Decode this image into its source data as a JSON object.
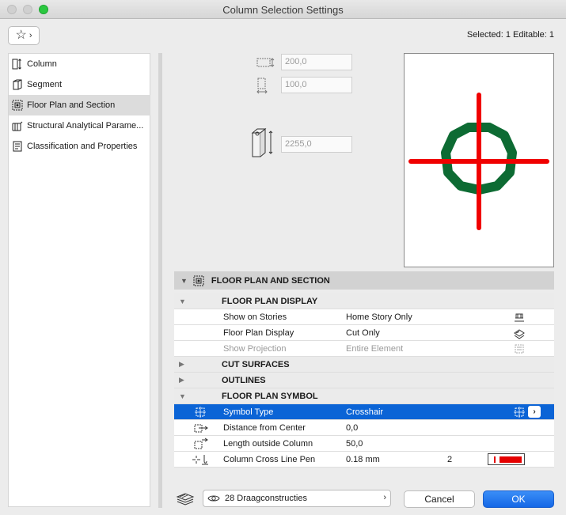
{
  "window": {
    "title": "Column Selection Settings"
  },
  "header": {
    "selection_info": "Selected: 1 Editable: 1",
    "favorites_icon": "star-icon"
  },
  "sidebar": {
    "items": [
      {
        "label": "Column",
        "icon": "column-icon"
      },
      {
        "label": "Segment",
        "icon": "segment-icon"
      },
      {
        "label": "Floor Plan and Section",
        "icon": "floor-plan-icon",
        "active": true
      },
      {
        "label": "Structural Analytical Parame...",
        "icon": "structural-analytical-icon"
      },
      {
        "label": "Classification and Properties",
        "icon": "classification-icon"
      }
    ]
  },
  "dimensions": {
    "width": "200,0",
    "depth": "100,0",
    "height": "2255,0"
  },
  "panel": {
    "title": "FLOOR PLAN AND SECTION",
    "groups": {
      "floor_plan_display": "FLOOR PLAN DISPLAY",
      "cut_surfaces": "CUT SURFACES",
      "outlines": "OUTLINES",
      "floor_plan_symbol": "FLOOR PLAN SYMBOL"
    },
    "rows": {
      "show_on_stories": {
        "name": "Show on Stories",
        "value": "Home Story Only"
      },
      "floor_plan_display": {
        "name": "Floor Plan Display",
        "value": "Cut Only"
      },
      "show_projection": {
        "name": "Show Projection",
        "value": "Entire Element"
      },
      "symbol_type": {
        "name": "Symbol Type",
        "value": "Crosshair"
      },
      "distance_from_center": {
        "name": "Distance from Center",
        "value": "0,0"
      },
      "length_outside_column": {
        "name": "Length outside Column",
        "value": "50,0"
      },
      "column_cross_line_pen": {
        "name": "Column Cross Line Pen",
        "value": "0.18 mm",
        "pen_number": "2",
        "pen_color": "#e50000"
      }
    }
  },
  "footer": {
    "layer": "28 Draagconstructies",
    "cancel": "Cancel",
    "ok": "OK"
  },
  "colors": {
    "accent": "#0b64d6",
    "preview_ring": "#0d6b33",
    "preview_cross": "#f00000"
  }
}
